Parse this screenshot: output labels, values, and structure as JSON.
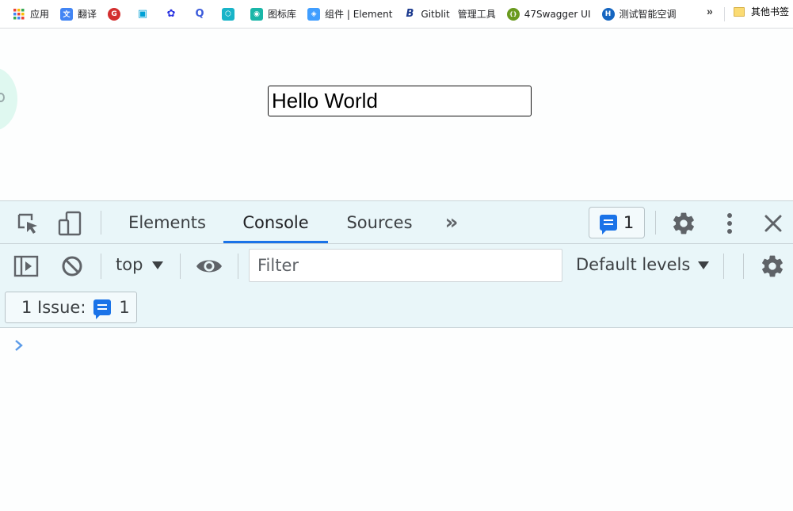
{
  "bookmarks": {
    "items": [
      {
        "label": "应用",
        "icon": "apps-grid-icon",
        "color": "#ea4335"
      },
      {
        "label": "翻译",
        "icon": "translate-icon",
        "color": "#4285f4"
      },
      {
        "label": "",
        "icon": "g-logo-icon",
        "color": "#d32f2f"
      },
      {
        "label": "",
        "icon": "bilibili-icon",
        "color": "#00a1d6"
      },
      {
        "label": "",
        "icon": "baidu-paw-icon",
        "color": "#2932e1"
      },
      {
        "label": "",
        "icon": "search-circle-icon",
        "color": "#3b5bdb"
      },
      {
        "label": "",
        "icon": "hex-logo-icon",
        "color": "#18b4c8"
      },
      {
        "label": "图标库",
        "icon": "iconfont-icon",
        "color": "#1ab6a8"
      },
      {
        "label": "组件 | Element",
        "icon": "element-icon",
        "color": "#409eff"
      },
      {
        "label": "Gitblit",
        "icon": "gitblit-icon",
        "color": "#1d3b8f"
      },
      {
        "label": "管理工具",
        "icon": "",
        "color": ""
      },
      {
        "label": "47Swagger UI",
        "icon": "swagger-icon",
        "color": "#6a9a1f"
      },
      {
        "label": "测试智能空调",
        "icon": "h-logo-icon",
        "color": "#1565c0"
      }
    ],
    "more": "»",
    "other_label": "其他书签"
  },
  "page": {
    "input_value": "Hello World"
  },
  "devtools": {
    "tabs": [
      "Elements",
      "Console",
      "Sources"
    ],
    "active_tab": "Console",
    "more_tabs": "»",
    "issues_count": "1",
    "context": "top",
    "filter_placeholder": "Filter",
    "levels": "Default levels",
    "issue_label": "1 Issue:",
    "issue_count": "1",
    "accent": "#1a73e8"
  }
}
